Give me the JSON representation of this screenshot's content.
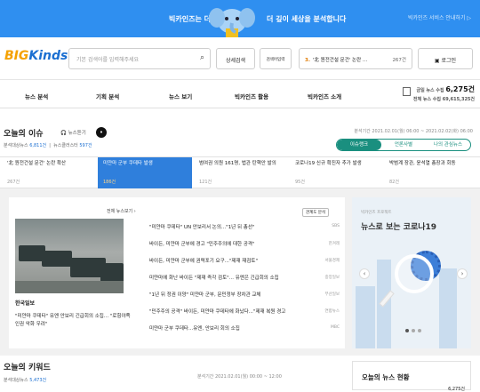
{
  "banner": {
    "text_left": "빅카인즈는 더 넓게,",
    "text_right": "더 깊이 세상을 분석합니다",
    "small": "빅카인즈 서비스 안내하기 ▷"
  },
  "header": {
    "logo_main": "BIG",
    "logo_accent": "Kinds",
    "search_placeholder": "기본 검색어를 입력해주세요",
    "detail_search": "상세검색",
    "keyword_search": "검색어입력",
    "trend_rank": "3.",
    "trend_text": "'北 원전건설 문건' 논란 …",
    "trend_count": "267건",
    "login": "로그인"
  },
  "nav": {
    "items": [
      "뉴스 분석",
      "기획 분석",
      "뉴스 보기",
      "빅카인즈 활용",
      "빅카인즈 소개"
    ],
    "stats_label1": "금일 뉴스 수집",
    "stats_value1": "6,275건",
    "stats_label2": "전체 뉴스 수집",
    "stats_value2": "69,615,325건"
  },
  "issue": {
    "title": "오늘의 이슈",
    "listen": "뉴스듣기",
    "period": "분석기간 2021.02.01(월) 06:00 ~ 2021.02.02(화) 06:00",
    "sub_news_label": "분석대상뉴스",
    "sub_news_value": "6,811건",
    "sub_cluster_label": "뉴스클러스터",
    "sub_cluster_value": "597건",
    "tabs": [
      "이슈랭크",
      "언론사별",
      "나의 관심뉴스"
    ],
    "items": [
      {
        "title": "'北 원전건설 문건' 논란 확산",
        "count": "267건"
      },
      {
        "title": "미얀마 군부 쿠데타 발생",
        "count": "186건"
      },
      {
        "title": "범여권 의원 161명, 법관 탄핵안 발의",
        "count": "121건"
      },
      {
        "title": "코로나19 신규 확진자 추가 발생",
        "count": "95건"
      },
      {
        "title": "박범계 장관, 윤석열 총장과 회동",
        "count": "82건"
      }
    ]
  },
  "detail": {
    "more": "전체 뉴스보기 ›",
    "related": "관계도 분석",
    "press_main": "한국일보",
    "caption": "\"미얀마 쿠데타\" 유엔 안보리 긴급회의 소집... \"로힝야족 인권 악화 우려\"",
    "news": [
      {
        "title": "\"미얀마 쿠데타\" UN 안보리서 논의...\"1년 뒤 총선\"",
        "press": "SBS"
      },
      {
        "title": "바이든, 미얀마 군부에 경고 \"민주주의에 대한 공격\"",
        "press": "한겨레"
      },
      {
        "title": "바이든, 미얀마 군부에 권력포기 요구...\"제재 재검토\"",
        "press": "서울경제"
      },
      {
        "title": "미얀마에 화난 바이든 \"제재 즉각 검토\"... 유엔은 긴급회의 소집",
        "press": "중앙일보"
      },
      {
        "title": "\"1년 뒤 정권 이양\" 미얀마 군부, 문민정부 장차관 교체",
        "press": "부산일보"
      },
      {
        "title": "\"민주주의 공격\" 바이든, 미얀마 쿠데타에 화났다...\"제재 복원 경고",
        "press": "연합뉴스"
      },
      {
        "title": "미얀마 군부 쿠데타...유엔, 안보리 회의 소집",
        "press": "MBC"
      }
    ]
  },
  "covid": {
    "kicker": "빅카인즈 프로젝트",
    "title": "뉴스로 보는 코로나19"
  },
  "keyword": {
    "title": "오늘의 키워드",
    "period": "분석기간 2021.02.01(월) 00:00 ~ 12:00",
    "sub_label": "분석대상뉴스",
    "sub_value": "5,473건"
  },
  "today_news": {
    "title": "오늘의 뉴스 현황",
    "value": "6,275건"
  }
}
